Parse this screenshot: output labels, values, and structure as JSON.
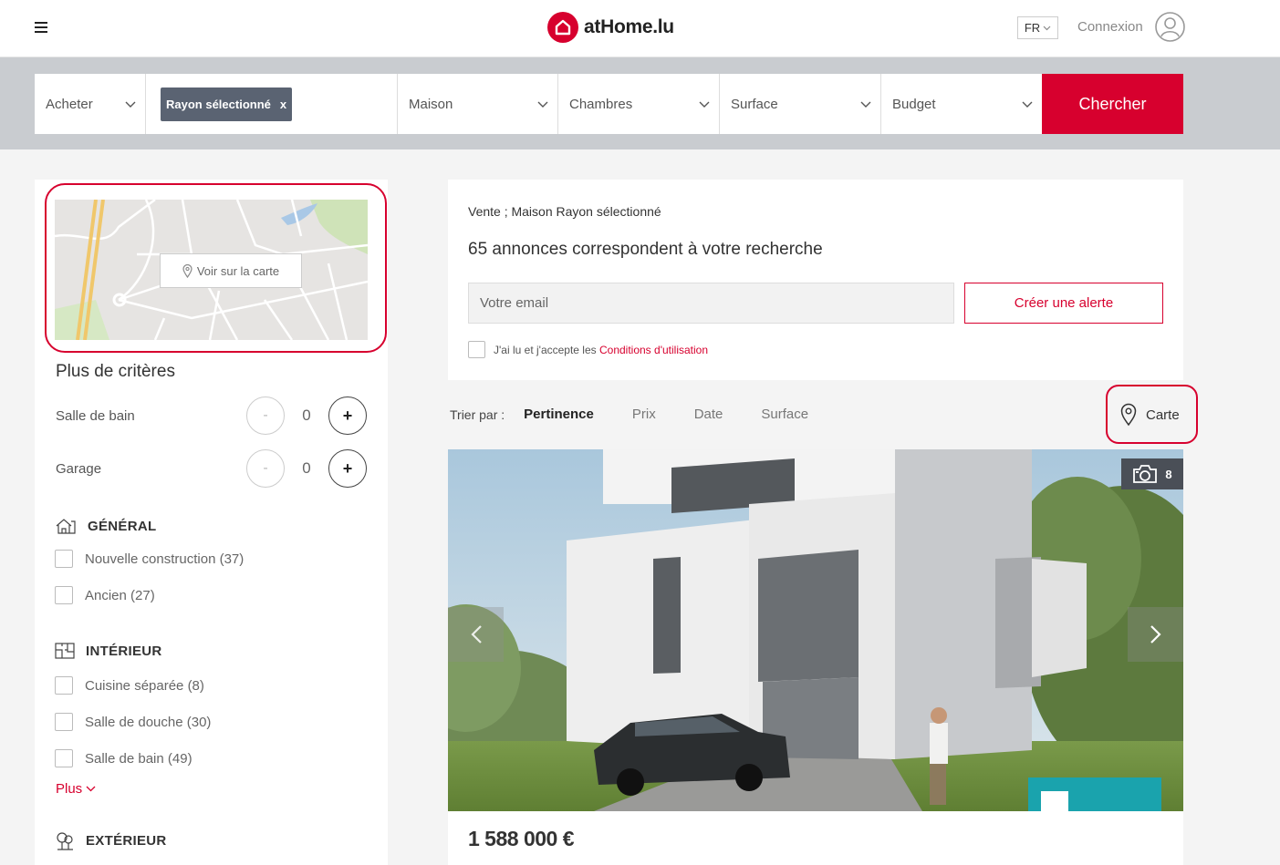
{
  "header": {
    "logo_text": "atHome.lu",
    "lang": "FR",
    "login_label": "Connexion"
  },
  "search": {
    "transaction": "Acheter",
    "radius_chip": "Rayon sélectionné",
    "chip_remove": "x",
    "property_type": "Maison",
    "bedrooms": "Chambres",
    "surface": "Surface",
    "budget": "Budget",
    "submit_label": "Chercher"
  },
  "sidebar": {
    "map_button": "Voir sur la carte",
    "criteria_title": "Plus de critères",
    "steppers": [
      {
        "label": "Salle de bain",
        "value": "0",
        "minus": "-",
        "plus": "+"
      },
      {
        "label": "Garage",
        "value": "0",
        "minus": "-",
        "plus": "+"
      }
    ],
    "sections": {
      "general": {
        "title": "GÉNÉRAL",
        "options": [
          "Nouvelle construction (37)",
          "Ancien (27)"
        ]
      },
      "interior": {
        "title": "INTÉRIEUR",
        "options": [
          "Cuisine séparée (8)",
          "Salle de douche (30)",
          "Salle de bain (49)"
        ]
      },
      "more_label": "Plus",
      "exterior": {
        "title": "EXTÉRIEUR"
      }
    }
  },
  "results": {
    "breadcrumb": "Vente ; Maison Rayon sélectionné",
    "count_text": "65 annonces correspondent à votre recherche",
    "email_placeholder": "Votre email",
    "alert_button": "Créer une alerte",
    "terms_text": "J'ai lu et j'accepte les ",
    "terms_link": "Conditions d'utilisation"
  },
  "sort": {
    "label": "Trier par :",
    "options": [
      "Pertinence",
      "Prix",
      "Date",
      "Surface"
    ],
    "active": "Pertinence",
    "map_label": "Carte"
  },
  "listing": {
    "photo_count": "8",
    "price": "1 588 000 €"
  },
  "colors": {
    "brand_red": "#d7002e",
    "chip_gray": "#5a6372",
    "search_band": "#c9ccd0"
  }
}
